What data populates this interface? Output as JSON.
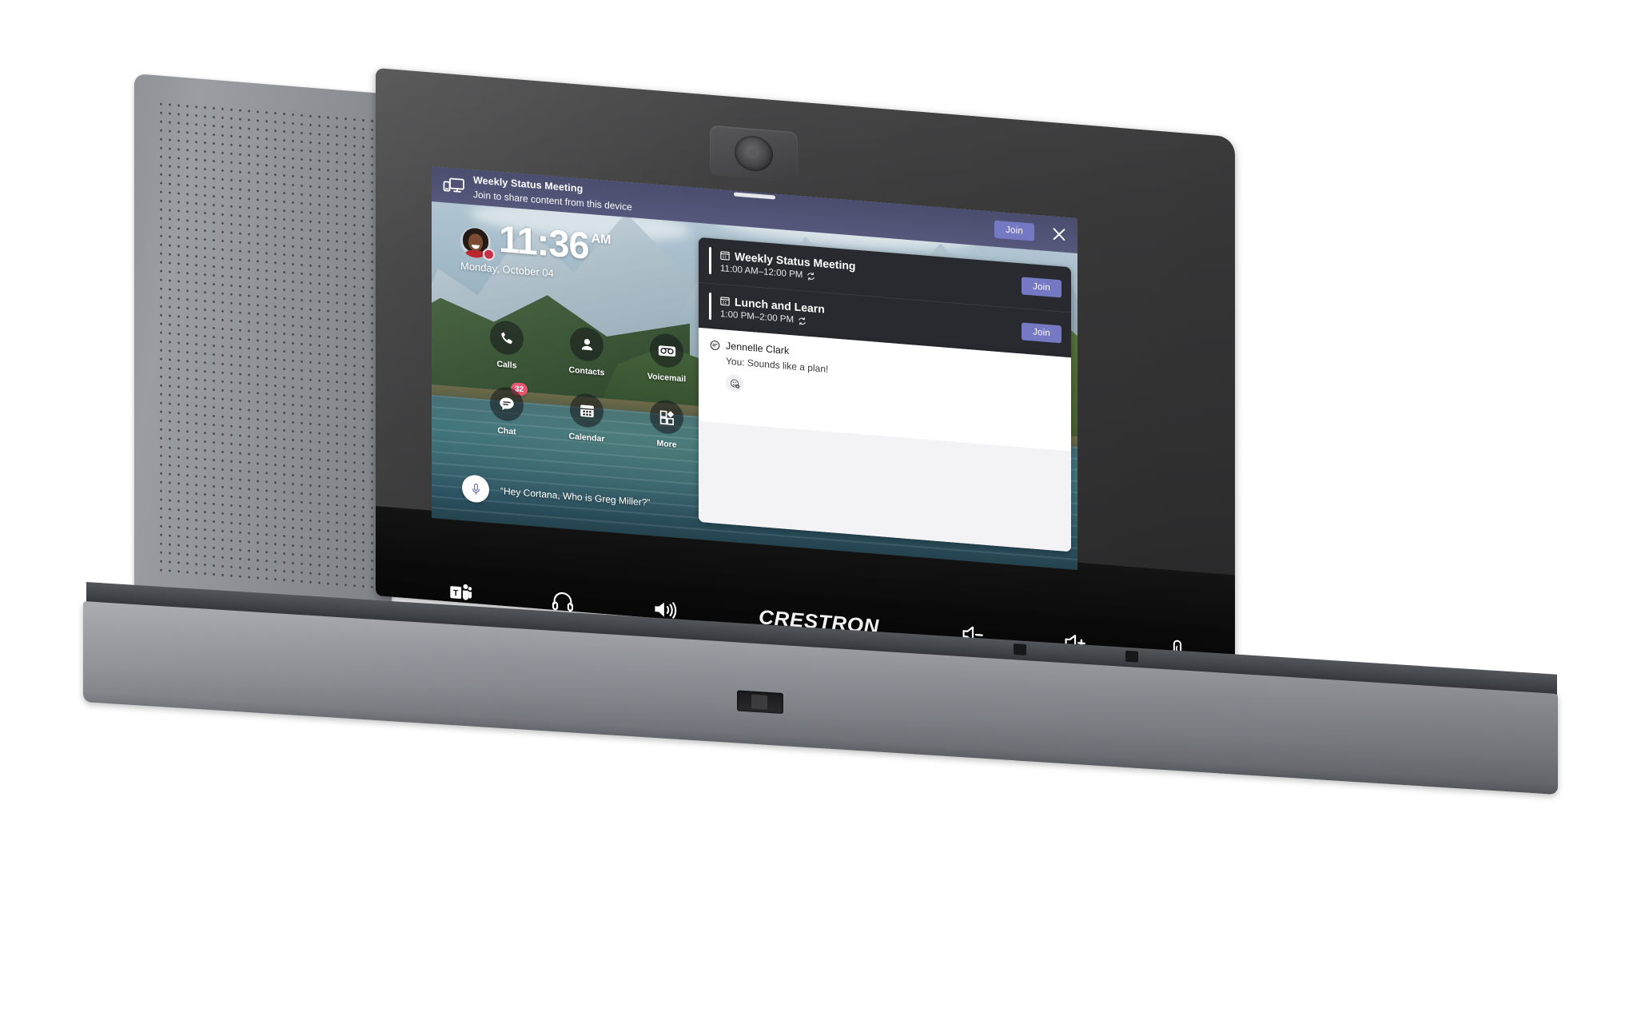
{
  "device": {
    "brand": "CRESTRON",
    "hardware_buttons": [
      {
        "name": "teams-button",
        "label": "Teams"
      },
      {
        "name": "headset-button",
        "label": "Headset"
      },
      {
        "name": "speaker-button",
        "label": "Speaker"
      },
      {
        "name": "volume-down-button",
        "label": "Volume Down"
      },
      {
        "name": "volume-up-button",
        "label": "Volume Up"
      },
      {
        "name": "mute-mic-button",
        "label": "Mute Microphone"
      }
    ]
  },
  "banner": {
    "title": "Weekly Status Meeting",
    "subtitle": "Join to share content from this device",
    "join_label": "Join",
    "icon": "share-screen-icon",
    "close_icon": "close-icon",
    "background_color": "#4f5274",
    "join_color": "#7579c4"
  },
  "clock": {
    "time": "11:36",
    "meridiem": "AM",
    "date": "Monday, October 04",
    "presence_color": "#c4314b"
  },
  "apps": [
    {
      "label": "Calls",
      "icon": "phone-icon",
      "badge": null
    },
    {
      "label": "Contacts",
      "icon": "person-icon",
      "badge": null
    },
    {
      "label": "Voicemail",
      "icon": "voicemail-icon",
      "badge": null
    },
    {
      "label": "Chat",
      "icon": "chat-icon",
      "badge": "32"
    },
    {
      "label": "Calendar",
      "icon": "calendar-icon",
      "badge": null
    },
    {
      "label": "More",
      "icon": "more-apps-icon",
      "badge": null
    }
  ],
  "badge_color": "#e8566f",
  "cortana": {
    "prompt": "“Hey Cortana, Who is Greg Miller?”",
    "icon": "microphone-icon"
  },
  "meetings": {
    "join_label": "Join",
    "items": [
      {
        "title": "Weekly Status Meeting",
        "time": "11:00 AM–12:00 PM",
        "icon": "calendar-small-icon",
        "recurring_icon": "recurring-icon",
        "join_label": "Join"
      },
      {
        "title": "Lunch and Learn",
        "time": "1:00 PM–2:00 PM",
        "icon": "calendar-small-icon",
        "recurring_icon": "recurring-icon",
        "join_label": "Join"
      }
    ]
  },
  "chat": {
    "sender": "Jennelle Clark",
    "preview": "You: Sounds like a plan!",
    "sender_icon": "chat-bubble-icon",
    "react_icon": "add-reaction-icon"
  }
}
